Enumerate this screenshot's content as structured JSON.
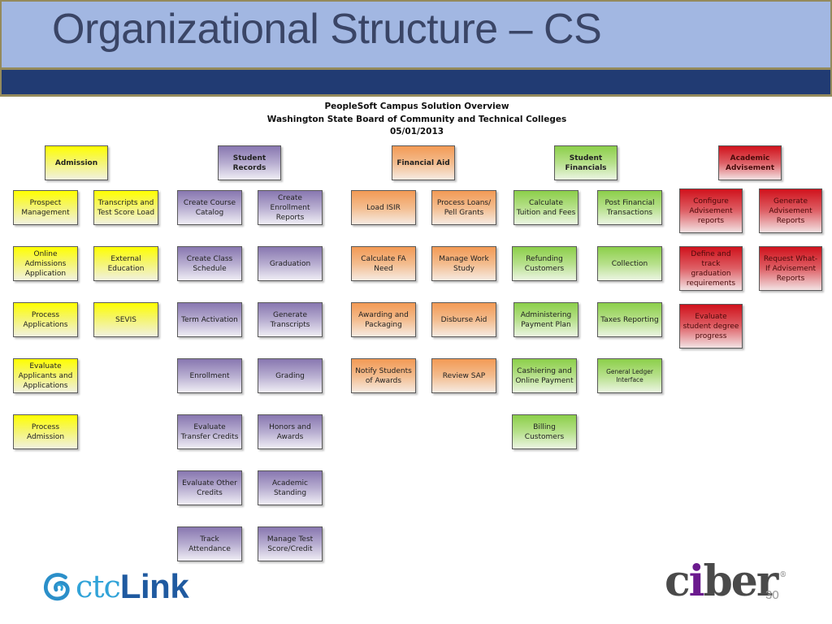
{
  "slide": {
    "title": "Organizational Structure – CS",
    "page_number": "30"
  },
  "overview": {
    "line1": "PeopleSoft Campus Solution Overview",
    "line2": "Washington State Board of Community and Technical Colleges",
    "line3": "05/01/2013"
  },
  "colors": {
    "title_band": "#a2b7e2",
    "navy_band": "#213b73",
    "admission": "#ffff00",
    "student_records": "#8877b0",
    "financial_aid": "#f39a55",
    "student_financials": "#8ccf4a",
    "academic_advisement": "#d0121c"
  },
  "modules": {
    "admission": {
      "header": "Admission",
      "items": [
        "Prospect Management",
        "Transcripts and Test Score Load",
        "Online Admissions Application",
        "External Education",
        "Process Applications",
        "SEVIS",
        "Evaluate Applicants and Applications",
        "Process Admission"
      ]
    },
    "student_records": {
      "header": "Student Records",
      "items": [
        "Create Course Catalog",
        "Create Enrollment Reports",
        "Create Class Schedule",
        "Graduation",
        "Term Activation",
        "Generate Transcripts",
        "Enrollment",
        "Grading",
        "Evaluate Transfer Credits",
        "Honors and Awards",
        "Evaluate Other Credits",
        "Academic Standing",
        "Track Attendance",
        "Manage Test Score/Credit"
      ]
    },
    "financial_aid": {
      "header": "Financial Aid",
      "items": [
        "Load ISIR",
        "Process Loans/ Pell Grants",
        "Calculate FA Need",
        "Manage Work Study",
        "Awarding and Packaging",
        "Disburse Aid",
        "Notify Students of Awards",
        "Review SAP"
      ]
    },
    "student_financials": {
      "header": "Student Financials",
      "items": [
        "Calculate Tuition and Fees",
        "Post Financial Transactions",
        "Refunding Customers",
        "Collection",
        "Administering Payment Plan",
        "Taxes Reporting",
        "Cashiering and Online Payment",
        "General Ledger Interface",
        "Billing Customers"
      ]
    },
    "academic_advisement": {
      "header": "Academic Advisement",
      "items": [
        "Configure Advisement reports",
        "Generate Advisement Reports",
        "Define and track graduation requirements",
        "Request What-If Advisement Reports",
        "Evaluate student degree progress"
      ]
    }
  },
  "logos": {
    "left_prefix": "ctc",
    "left_suffix": "Link",
    "right_c": "c",
    "right_i": "i",
    "right_ber": "ber",
    "right_reg": "®",
    "left_icon": "ctclink-swirl-icon"
  }
}
